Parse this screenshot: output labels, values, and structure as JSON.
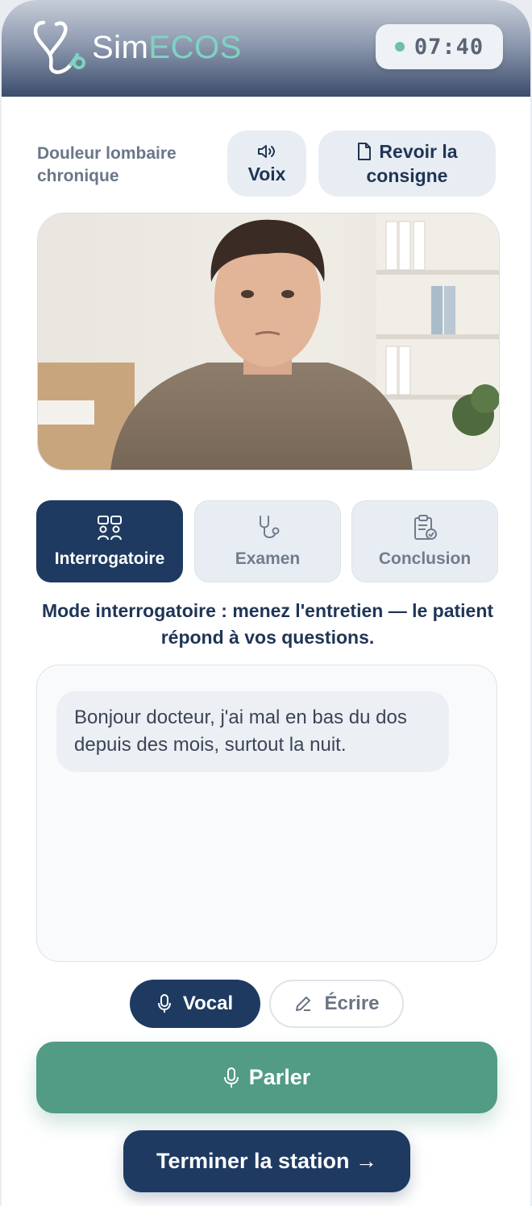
{
  "app": {
    "brand_part1": "Sim",
    "brand_part2": "ECOS",
    "timer": "07:40"
  },
  "case": {
    "title": "Douleur lombaire chronique",
    "voice_label": "Voix",
    "consigne_label_line1": "Revoir la",
    "consigne_label_line2": "consigne"
  },
  "tabs": [
    {
      "label": "Interrogatoire",
      "icon": "interview-icon",
      "active": true
    },
    {
      "label": "Examen",
      "icon": "stethoscope-icon",
      "active": false
    },
    {
      "label": "Conclusion",
      "icon": "clipboard-check-icon",
      "active": false
    }
  ],
  "mode_hint": "Mode interrogatoire : menez l'entretien — le patient répond à vos questions.",
  "chat": {
    "messages": [
      {
        "from": "patient",
        "text": "Bonjour docteur, j'ai mal en bas du dos depuis des mois, surtout la nuit."
      }
    ]
  },
  "input_mode": {
    "vocal_label": "Vocal",
    "ecrire_label": "Écrire",
    "selected": "Vocal"
  },
  "actions": {
    "parler_label": "Parler",
    "terminer_label": "Terminer la station →"
  },
  "colors": {
    "navy": "#1e3a61",
    "teal": "#529b85",
    "accent": "#7fd3c3",
    "timer_dot": "#6cc1a4"
  }
}
